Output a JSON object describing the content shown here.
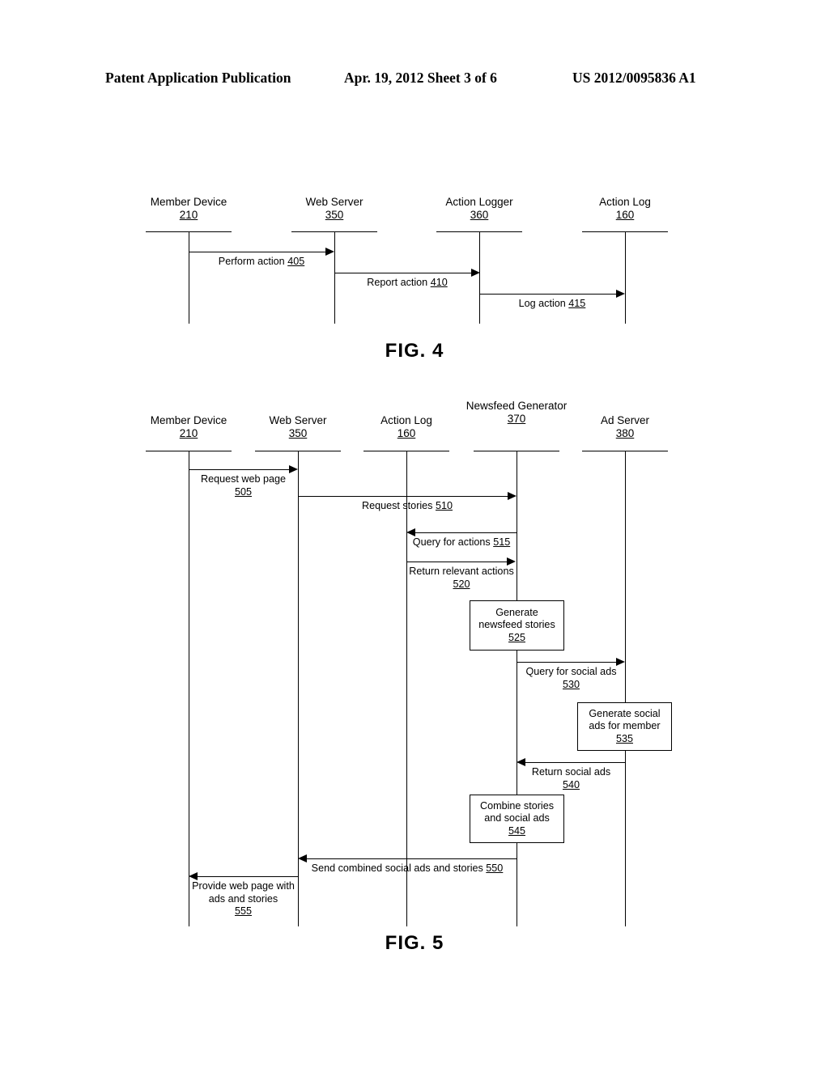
{
  "header": {
    "title": "Patent Application Publication",
    "date_sheet": "Apr. 19, 2012  Sheet 3 of 6",
    "publication_number": "US 2012/0095836 A1"
  },
  "figures": [
    {
      "id": "fig4",
      "caption": "FIG. 4",
      "lifelines": [
        {
          "label": "Member Device",
          "ref": "210"
        },
        {
          "label": "Web Server",
          "ref": "350"
        },
        {
          "label": "Action Logger",
          "ref": "360"
        },
        {
          "label": "Action Log",
          "ref": "160"
        }
      ],
      "messages": [
        {
          "text": "Perform action",
          "ref": "405",
          "direction": "right",
          "from": "Member Device",
          "to": "Web Server"
        },
        {
          "text": "Report action",
          "ref": "410",
          "direction": "right",
          "from": "Web Server",
          "to": "Action Logger"
        },
        {
          "text": "Log action",
          "ref": "415",
          "direction": "right",
          "from": "Action Logger",
          "to": "Action Log"
        }
      ]
    },
    {
      "id": "fig5",
      "caption": "FIG. 5",
      "lifelines": [
        {
          "label": "Member Device",
          "ref": "210"
        },
        {
          "label": "Web Server",
          "ref": "350"
        },
        {
          "label": "Action Log",
          "ref": "160"
        },
        {
          "label": "Newsfeed Generator",
          "ref": "370"
        },
        {
          "label": "Ad Server",
          "ref": "380"
        }
      ],
      "messages": [
        {
          "text": "Request web page",
          "ref": "505",
          "direction": "right",
          "from": "Member Device",
          "to": "Web Server"
        },
        {
          "text": "Request stories",
          "ref": "510",
          "direction": "right",
          "from": "Web Server",
          "to": "Newsfeed Generator"
        },
        {
          "text": "Query for actions",
          "ref": "515",
          "direction": "left",
          "from": "Newsfeed Generator",
          "to": "Action Log"
        },
        {
          "text": "Return relevant actions",
          "ref": "520",
          "direction": "right",
          "from": "Action Log",
          "to": "Newsfeed Generator"
        },
        {
          "text": "Query for social ads",
          "ref": "530",
          "direction": "right",
          "from": "Newsfeed Generator",
          "to": "Ad Server"
        },
        {
          "text": "Return social ads",
          "ref": "540",
          "direction": "left",
          "from": "Ad Server",
          "to": "Newsfeed Generator"
        },
        {
          "text": "Send combined social ads and stories",
          "ref": "550",
          "direction": "left",
          "from": "Newsfeed Generator",
          "to": "Web Server"
        },
        {
          "text": "Provide web page with ads and stories",
          "ref": "555",
          "direction": "left",
          "from": "Web Server",
          "to": "Member Device"
        }
      ],
      "process_boxes": [
        {
          "text_line1": "Generate",
          "text_line2": "newsfeed stories",
          "ref": "525",
          "on": "Newsfeed Generator"
        },
        {
          "text_line1": "Generate social",
          "text_line2": "ads for member",
          "ref": "535",
          "on": "Ad Server"
        },
        {
          "text_line1": "Combine stories",
          "text_line2": "and social ads",
          "ref": "545",
          "on": "Newsfeed Generator"
        }
      ]
    }
  ],
  "colors": {
    "ink": "#000000",
    "paper": "#ffffff"
  }
}
